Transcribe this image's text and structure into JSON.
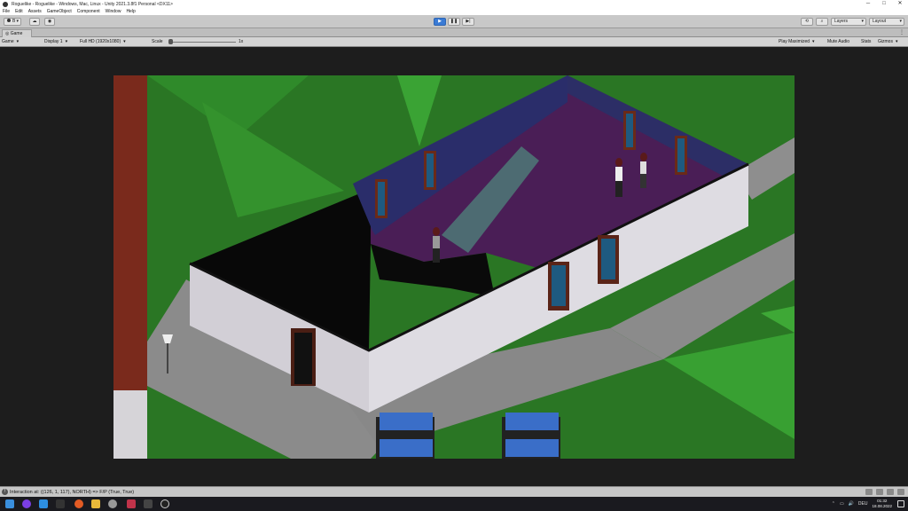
{
  "window": {
    "title": "Roguelike - Roguelike - Windows, Mac, Linux - Unity 2021.3.8f1 Personal <DX11>",
    "controls": [
      "─",
      "□",
      "✕"
    ]
  },
  "menu": [
    "File",
    "Edit",
    "Assets",
    "GameObject",
    "Component",
    "Window",
    "Help"
  ],
  "toolbar": {
    "account_label": "B",
    "layers_label": "Layers",
    "layout_label": "Layout"
  },
  "game_tab": {
    "label": "Game"
  },
  "game_bar": {
    "view_mode": "Game",
    "display": "Display 1",
    "resolution": "Full HD (1920x1080)",
    "scale_label": "Scale",
    "scale_value": "1x",
    "play_maximized": "Play Maximized",
    "mute_audio": "Mute Audio",
    "stats": "Stats",
    "gizmos": "Gizmos"
  },
  "status": {
    "message": "Interaction at: ((126, 1, 117), NORTH) => F/P (True, True)"
  },
  "taskbar": {
    "language": "DEU",
    "time": "01:32",
    "date": "18.08.2022"
  },
  "colors": {
    "grass": "#2d7a25",
    "road": "#8c8c8c",
    "floor": "#4a1e56",
    "brick": "#7a2a1c",
    "siding": "#d2cfd6",
    "play_accent": "#3a7bd5"
  }
}
